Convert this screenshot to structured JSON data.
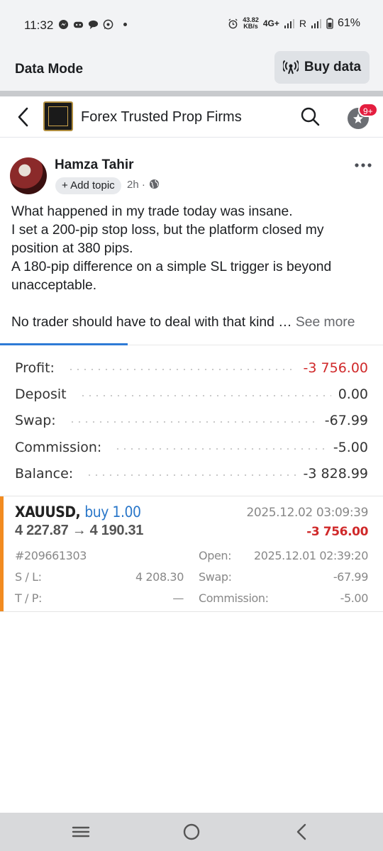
{
  "status_bar": {
    "time": "11:32",
    "net_speed_value": "43.82",
    "net_speed_unit": "KB/s",
    "network_type": "4G+",
    "roaming": "R",
    "battery": "61%",
    "icons": [
      "messenger-icon",
      "discord-icon",
      "chat-icon",
      "whatsapp-icon",
      "alarm-icon",
      "signal-icon",
      "battery-icon"
    ]
  },
  "data_mode": {
    "title": "Data Mode",
    "button_label": "Buy data"
  },
  "group_header": {
    "group_name": "Forex Trusted Prop Firms",
    "notification_badge": "9+"
  },
  "post": {
    "author": "Hamza Tahir",
    "add_topic_label": "Add topic",
    "time": "2h ·",
    "lines": [
      "What happened in my trade today was insane.",
      "I set a 200-pip stop loss, but the platform closed my position at 380 pips.",
      "A 180-pip difference on a simple SL trigger is beyond unacceptable."
    ],
    "truncated_line": "No trader should have to deal with that kind …",
    "see_more": "See more"
  },
  "trade_screenshot": {
    "summary": [
      {
        "label": "Profit:",
        "value": "-3 756.00"
      },
      {
        "label": "Deposit",
        "value": "0.00"
      },
      {
        "label": "Swap:",
        "value": "-67.99"
      },
      {
        "label": "Commission:",
        "value": "-5.00"
      },
      {
        "label": "Balance:",
        "value": "-3 828.99"
      }
    ],
    "trade": {
      "symbol": "XAUUSD,",
      "direction": "buy 1.00",
      "prices": "4 227.87 → 4 190.31",
      "close_time": "2025.12.02 03:09:39",
      "profit": "-3 756.00",
      "ticket": "#209661303",
      "open_label": "Open:",
      "open_time": "2025.12.01 02:39:20",
      "sl_label": "S / L:",
      "sl_value": "4 208.30",
      "swap_label": "Swap:",
      "swap_value": "-67.99",
      "tp_label": "T / P:",
      "tp_value": "—",
      "commission_label": "Commission:",
      "commission_value": "-5.00"
    }
  },
  "colors": {
    "accent_blue": "#2e7bd6",
    "loss_red": "#d0292a",
    "badge_red": "#e41e3f",
    "trade_marker_orange": "#f28b20"
  }
}
